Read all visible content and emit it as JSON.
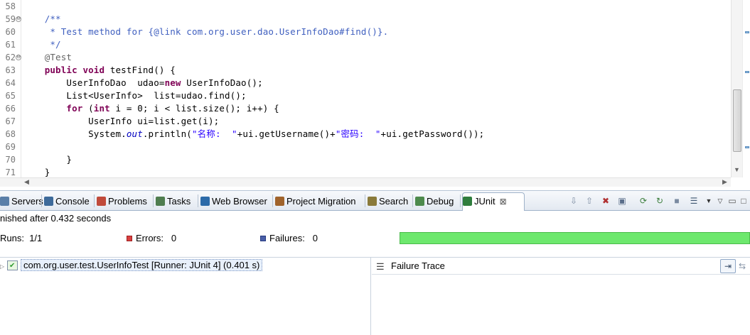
{
  "editor": {
    "line_numbers": [
      "58",
      "59",
      "60",
      "61",
      "62",
      "63",
      "64",
      "65",
      "66",
      "67",
      "68",
      "69",
      "70",
      "71"
    ],
    "fold_markers": {
      "59": "⊖",
      "62": "⊖"
    },
    "lines": [
      {
        "segs": []
      },
      {
        "segs": [
          {
            "c": "cm",
            "t": "    /**"
          }
        ]
      },
      {
        "segs": [
          {
            "c": "cm",
            "t": "     * Test method for {@link com.org.user.dao.UserInfoDao#find()}."
          }
        ]
      },
      {
        "segs": [
          {
            "c": "cm",
            "t": "     */"
          }
        ]
      },
      {
        "segs": [
          {
            "c": "an",
            "t": "    @Test"
          }
        ]
      },
      {
        "segs": [
          {
            "c": "",
            "t": "    "
          },
          {
            "c": "kw",
            "t": "public"
          },
          {
            "c": "",
            "t": " "
          },
          {
            "c": "kw",
            "t": "void"
          },
          {
            "c": "",
            "t": " testFind() {"
          }
        ]
      },
      {
        "segs": [
          {
            "c": "",
            "t": "        UserInfoDao  udao="
          },
          {
            "c": "kw",
            "t": "new"
          },
          {
            "c": "",
            "t": " UserInfoDao();"
          }
        ]
      },
      {
        "segs": [
          {
            "c": "",
            "t": "        List<UserInfo>  list=udao.find();"
          }
        ]
      },
      {
        "segs": [
          {
            "c": "",
            "t": "        "
          },
          {
            "c": "kw",
            "t": "for"
          },
          {
            "c": "",
            "t": " ("
          },
          {
            "c": "kw",
            "t": "int"
          },
          {
            "c": "",
            "t": " i = 0; i < list.size(); i++) {"
          }
        ]
      },
      {
        "segs": [
          {
            "c": "",
            "t": "            UserInfo ui=list.get(i);"
          }
        ]
      },
      {
        "segs": [
          {
            "c": "",
            "t": "            System."
          },
          {
            "c": "fi",
            "t": "out"
          },
          {
            "c": "",
            "t": ".println("
          },
          {
            "c": "st",
            "t": "\"名称:  \""
          },
          {
            "c": "",
            "t": "+ui.getUsername()+"
          },
          {
            "c": "st",
            "t": "\"密码:  \""
          },
          {
            "c": "",
            "t": "+ui.getPassword());"
          }
        ]
      },
      {
        "segs": []
      },
      {
        "segs": [
          {
            "c": "",
            "t": "        }"
          }
        ]
      },
      {
        "segs": [
          {
            "c": "",
            "t": "    }"
          }
        ]
      }
    ]
  },
  "tabs": [
    {
      "label": "Servers",
      "icon": "servers-icon",
      "color": "#5a7fa8"
    },
    {
      "label": "Console",
      "icon": "console-icon",
      "color": "#3d6a9a"
    },
    {
      "label": "Problems",
      "icon": "problems-icon",
      "color": "#c04a3a"
    },
    {
      "label": "Tasks",
      "icon": "tasks-icon",
      "color": "#4f7d4f"
    },
    {
      "label": "Web Browser",
      "icon": "globe-icon",
      "color": "#2b6aa8"
    },
    {
      "label": "Project Migration",
      "icon": "migration-icon",
      "color": "#a0632b"
    },
    {
      "label": "Search",
      "icon": "search-icon",
      "color": "#8a7a3a"
    },
    {
      "label": "Debug",
      "icon": "debug-icon",
      "color": "#4d8a4d"
    },
    {
      "label": "JUnit",
      "icon": "junit-icon",
      "color": "#2f7d3d",
      "active": true,
      "close": "⊠"
    }
  ],
  "junit": {
    "finished": "nished after 0.432 seconds",
    "runs_label": "Runs:",
    "runs_value": "1/1",
    "errors_label": "Errors:",
    "errors_value": "0",
    "failures_label": "Failures:",
    "failures_value": "0",
    "progress": 1.0,
    "progress_color": "#6de86d",
    "tree_item": "com.org.user.test.UserInfoTest [Runner: JUnit 4] (0.401 s)",
    "failure_trace_label": "Failure Trace"
  }
}
